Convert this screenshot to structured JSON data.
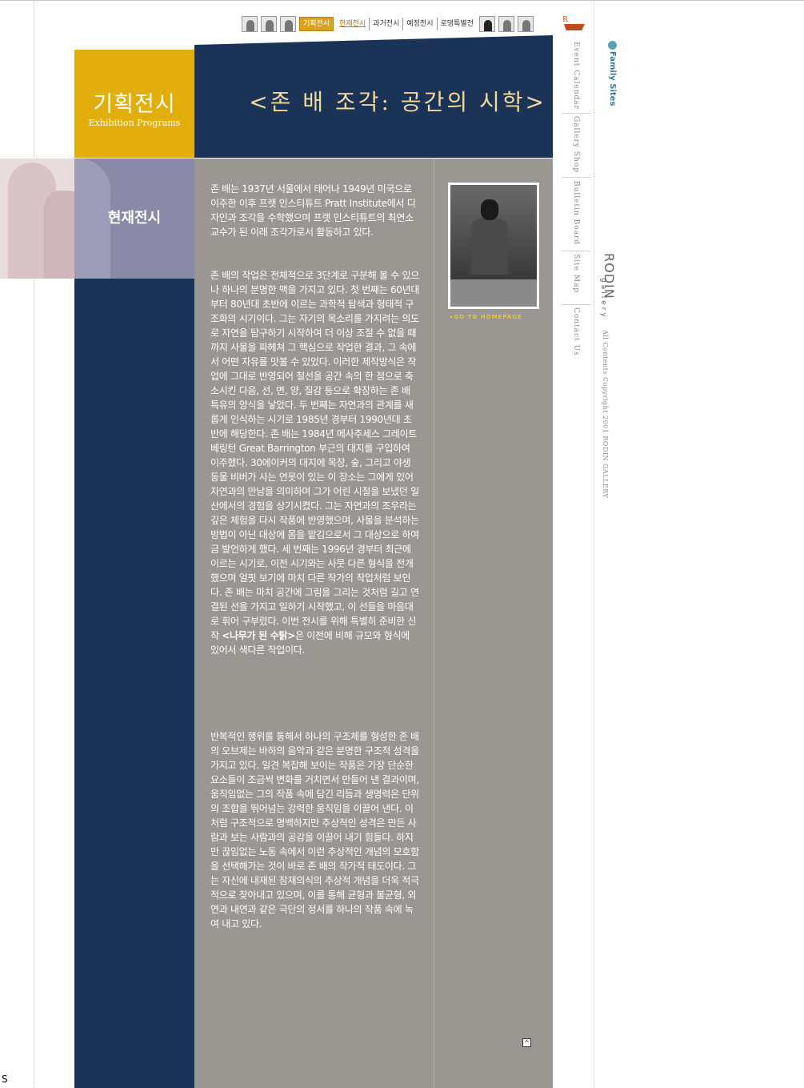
{
  "nav": {
    "tabs": [
      "기획전시",
      "현재전시",
      "과거전시",
      "예정전시",
      "로댕특별전"
    ]
  },
  "header": {
    "title_ko": "기획전시",
    "title_en": "Exhibition Programs",
    "exhibition_title": "<존 배 조각: 공간의 시학>"
  },
  "left": {
    "section_label": "현재전시"
  },
  "content": {
    "p1": "존 배는 1937년 서울에서 태어나 1949년 미국으로 이주한 이후 프랫 인스티튜트 Pratt Institute에서 디자인과 조각을 수학했으며 프랫 인스티튜트의 최연소 교수가 된 이래 조각가로서 활동하고 있다.",
    "p2a": "존 배의 작업은 전체적으로 3단계로 구분해 볼 수 있으나 하나의 분명한 맥을 가지고 있다. 첫 번째는 60년대부터 80년대 초반에 이르는 과학적 탐색과 형태적 구조화의 시기이다. 그는 자기의 목소리를 가지려는 의도로 자연을 탐구하기 시작하여 더 이상 조절 수 없을 때까지 사물을 파헤쳐 그 핵심으로 작업한 결과, 그 속에서 어떤 자유를 맛볼 수 있었다. 이러한 제작방식은 작업에 그대로 반영되어 철선을 공간 속의 한 점으로 축소시킨 다음, 선, 면, 양, 질감 등으로 확장하는 존 배 특유의 양식을 낳았다. 두 번째는 자연과의 관계를 새롭게 인식하는 시기로 1985년 경부터 1990년대 초반에 해당한다. 존 배는 1984년 메사추세스 그레이트 베링턴 Great Barrington 부근의 대지를 구입하여 이주했다. 30에이커의 대지에 목장, 숲, 그리고 야생 동물 비버가 사는 연못이 있는 이 장소는 그에게 있어 자연과의 만남을 의미하며 그가 어린 시절을 보냈던 일산에서의 경험을 상기시켰다. 그는 자연과의 조우라는 깊은 체험을 다시 작품에 반영했으며, 사물을 분석하는 방법이 아닌 대상에 몸을 맡김으로서 그 대상으로 하여금 발언하게 했다. 세 번째는 1996년 경부터 최근에 이르는 시기로, 이전 시기와는 사뭇 다른 형식을 전개했으며 얼핏 보기에 마치 다른 작가의 작업처럼 보인다. 존 배는 마치 공간에 그림을 그리는 것처럼 길고 연결된 선을 가지고 일하기 시작했고, 이 선들을 마음대로 휘어 구부렸다. 이번 전시를 위해 특별히 준비한 신작 ",
    "p2_bold": "<나무가 된 수탉>",
    "p2b": "은 이전에 비해 규모와 형식에 있어서 색다른 작업이다.",
    "p3": "반복적인 행위를 통해서 하나의 구조체를 형성한 존 배의 오브제는 바하의 음악과 같은 분명한 구조적 성격을 가지고 있다. 일견 복잡해 보이는 작품은 가장 단순한 요소들이 조금씩 변화를 거치면서 만들어 낸 결과이며, 움직임없는 그의 작품 속에 담긴 리듬과 생명력은 단위의 조합을 뛰어넘는 강력한 움직임을 이끌어 낸다. 이처럼 구조적으로 명백하지만 추상적인 성격은 만든 사람과 보는 사람과의 공감을 이끌어 내기 힘들다. 하지만 끊임없는 노동 속에서 이런 추상적인 개념의 모호함을 선택해가는 것이 바로 존 배의 작가적 태도이다. 그는 자신에 내재된 잠재의식의 추상적 개념을 더욱 적극적으로 찾아내고 있으며, 이를 통해 균형과 불균형, 외연과 내연과 같은 극단의 정서를 하나의 작품 속에 녹여 내고 있다."
  },
  "aside": {
    "go_home": "GO TO HOMEPAGE"
  },
  "right_nav": {
    "items": [
      "Event Calendar",
      "Gallery Shop",
      "Bulletin Board",
      "Site Map",
      "Contact Us"
    ],
    "family_sites": "Family Sites",
    "logo": "RODIN",
    "logo_sub": "gallery",
    "copyright": "All Contents Copyright 2001 RODIN GALLERY"
  },
  "footer": {
    "top_glyph": "^",
    "status": "S"
  },
  "colors": {
    "gold": "#e2ae0c",
    "navy": "#1c3358",
    "content_gray": "#9a9691"
  }
}
